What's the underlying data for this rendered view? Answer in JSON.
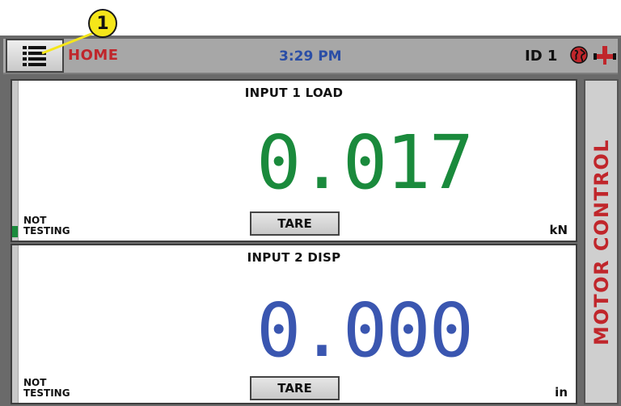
{
  "callout": {
    "number": "1"
  },
  "header": {
    "screen_title": "HOME",
    "time": "3:29 PM",
    "device_id": "ID 1"
  },
  "icons": {
    "menu": "hamburger-list-icon",
    "globe": "globe-icon",
    "connection": "plug-connector-icon"
  },
  "inputs": [
    {
      "title": "INPUT 1 LOAD",
      "value": "0.017",
      "unit": "kN",
      "status": "NOT\nTESTING",
      "tare_label": "TARE",
      "color": "#1a8a3c"
    },
    {
      "title": "INPUT 2 DISP",
      "value": "0.000",
      "unit": "in",
      "status": "NOT\nTESTING",
      "tare_label": "TARE",
      "color": "#3a56b0"
    }
  ],
  "side_button": {
    "label": "MOTOR CONTROL"
  },
  "colors": {
    "accent_red": "#c0262b",
    "time_blue": "#2b4ea6",
    "callout_yellow": "#f5e61a"
  }
}
